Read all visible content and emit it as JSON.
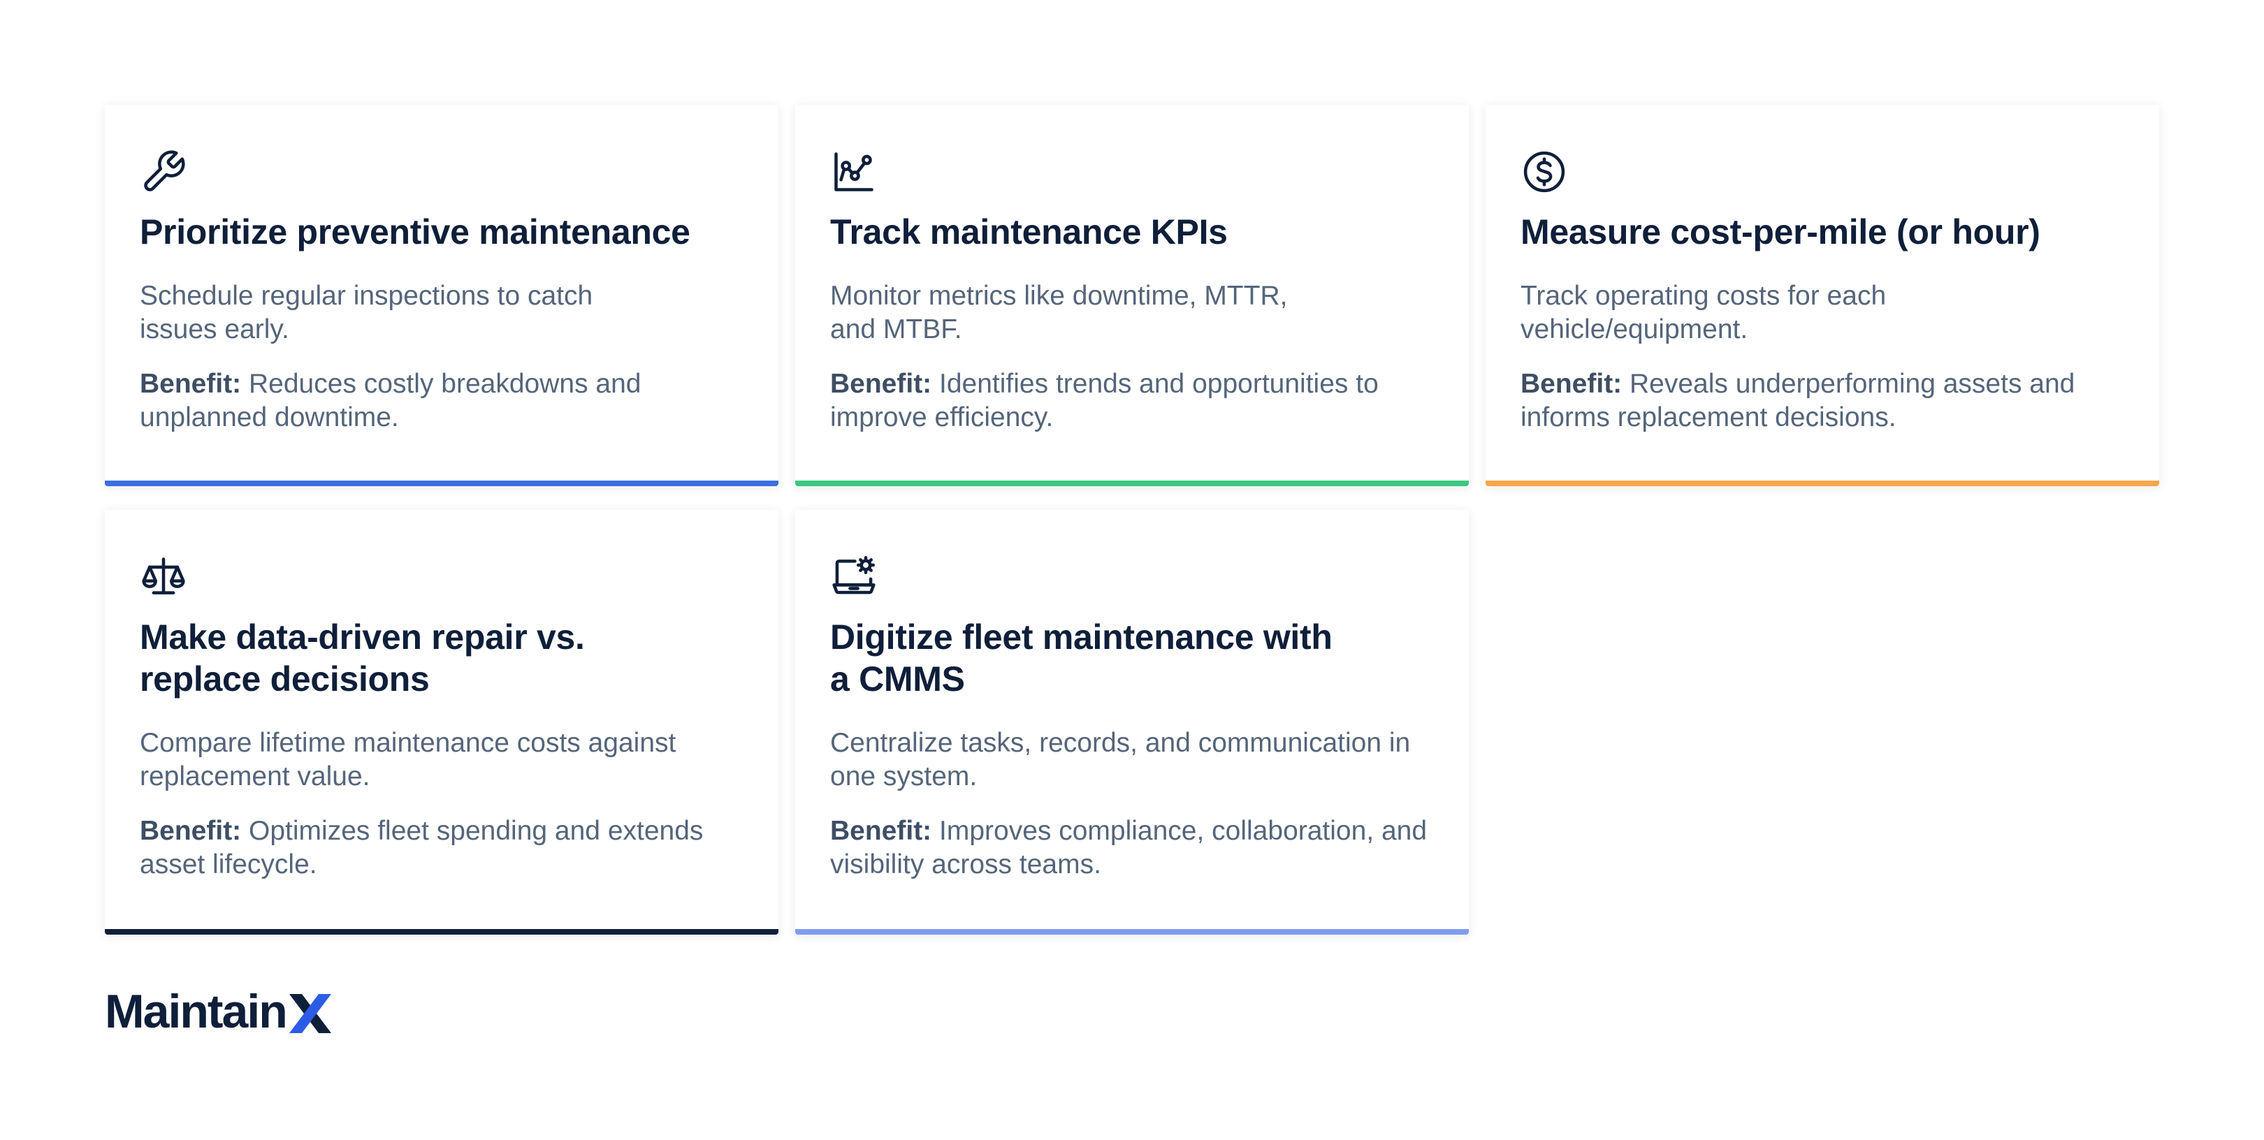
{
  "cards": [
    {
      "icon": "wrench-icon",
      "accent_color": "#3B6FE0",
      "title": "Prioritize preventive maintenance",
      "description": "Schedule regular inspections to catch\nissues early.",
      "benefit_label": "Benefit:",
      "benefit_text": "Reduces costly breakdowns and unplanned downtime."
    },
    {
      "icon": "chart-line-icon",
      "accent_color": "#3CC782",
      "title": "Track maintenance KPIs",
      "description": "Monitor metrics like downtime, MTTR,\nand MTBF.",
      "benefit_label": "Benefit:",
      "benefit_text": "Identifies trends and opportunities to improve efficiency."
    },
    {
      "icon": "dollar-circle-icon",
      "accent_color": "#F4A84A",
      "title": "Measure cost-per-mile (or hour)",
      "description": "Track operating costs for each\nvehicle/equipment.",
      "benefit_label": "Benefit:",
      "benefit_text": "Reveals underperforming assets and informs replacement decisions."
    },
    {
      "icon": "scales-icon",
      "accent_color": "#0F1F3A",
      "title": "Make data-driven repair vs.\nreplace decisions",
      "description": "Compare lifetime maintenance costs against replacement value.",
      "benefit_label": "Benefit:",
      "benefit_text": "Optimizes fleet spending and extends asset lifecycle."
    },
    {
      "icon": "laptop-gear-icon",
      "accent_color": "#7E9CF1",
      "title": "Digitize fleet maintenance with\na CMMS",
      "description": "Centralize tasks, records, and communication in one system.",
      "benefit_label": "Benefit:",
      "benefit_text": "Improves compliance, collaboration, and visibility across teams."
    }
  ],
  "logo": {
    "text": "Maintain",
    "mark": "X",
    "text_color": "#0F1F3A",
    "mark_color": "#2B5CE6"
  }
}
